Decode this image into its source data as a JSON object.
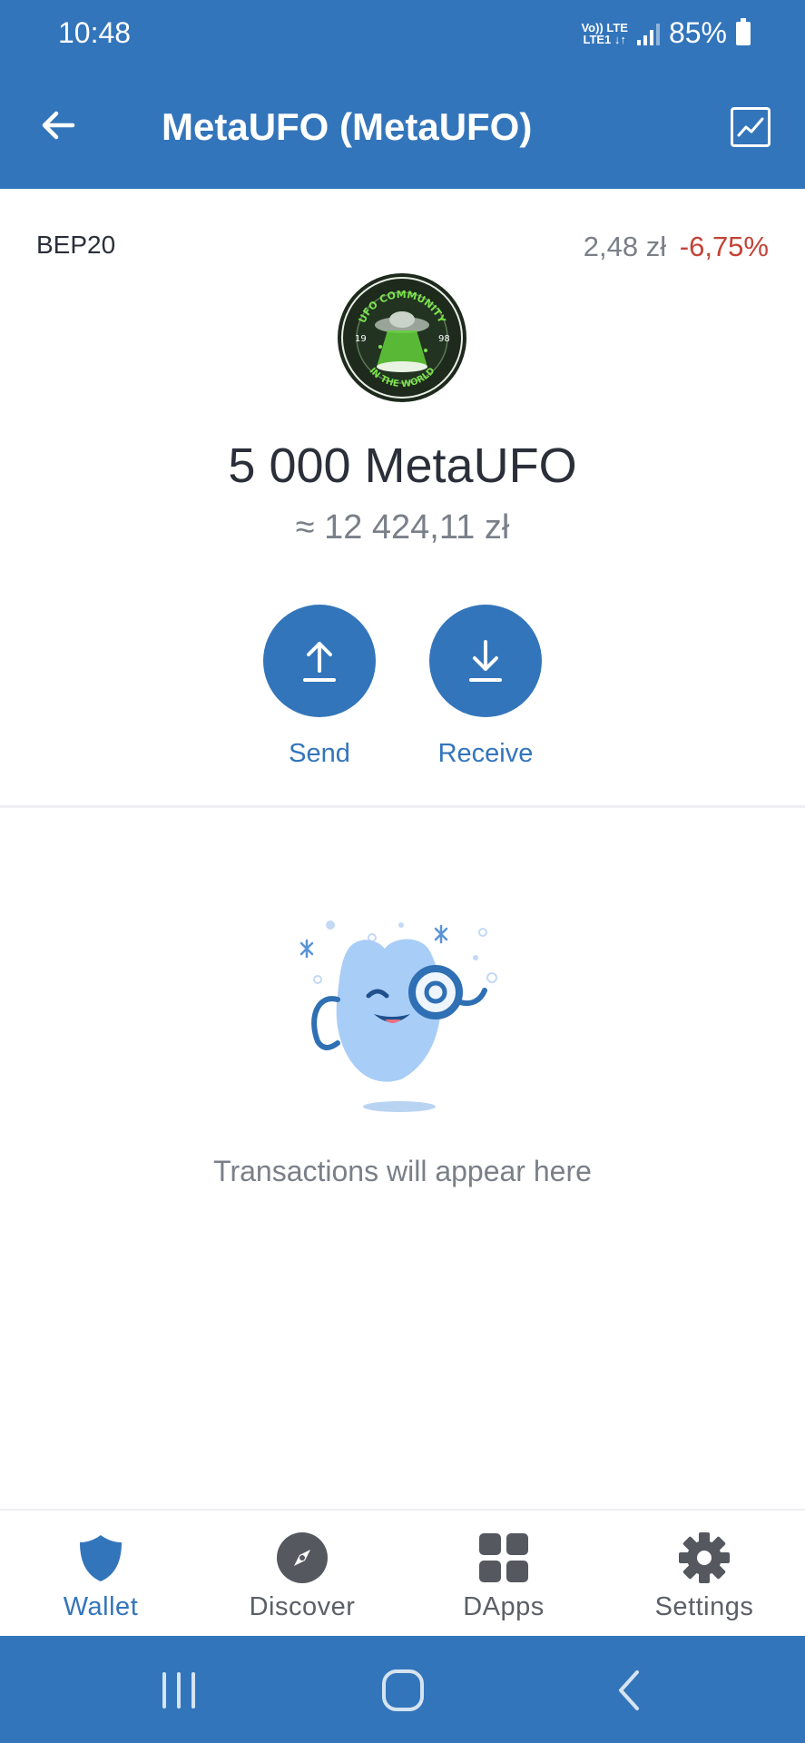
{
  "status_bar": {
    "time": "10:48",
    "network_top": "Vo)) LTE",
    "network_bottom": "LTE1 ↓↑",
    "battery": "85%"
  },
  "app_bar": {
    "title": "MetaUFO (MetaUFO)",
    "back_icon": "arrow-left-icon",
    "chart_icon": "chart-icon"
  },
  "token": {
    "network": "BEP20",
    "price": "2,48 zł",
    "price_change": "-6,75%",
    "logo_top_text": "UFO COMMUNITY",
    "logo_bottom_text": "IN THE WORLD",
    "logo_left_num": "19",
    "logo_right_num": "98",
    "balance": "5 000 MetaUFO",
    "fiat_balance": "≈ 12 424,11 zł"
  },
  "actions": {
    "send_label": "Send",
    "receive_label": "Receive"
  },
  "empty_state": {
    "text": "Transactions will appear here"
  },
  "bottom_nav": {
    "items": [
      {
        "label": "Wallet",
        "icon": "shield-icon",
        "active": true
      },
      {
        "label": "Discover",
        "icon": "compass-icon",
        "active": false
      },
      {
        "label": "DApps",
        "icon": "grid-icon",
        "active": false
      },
      {
        "label": "Settings",
        "icon": "gear-icon",
        "active": false
      }
    ]
  },
  "colors": {
    "brand": "#3375bb",
    "negative": "#c44236",
    "muted_text": "#7a7f88"
  }
}
